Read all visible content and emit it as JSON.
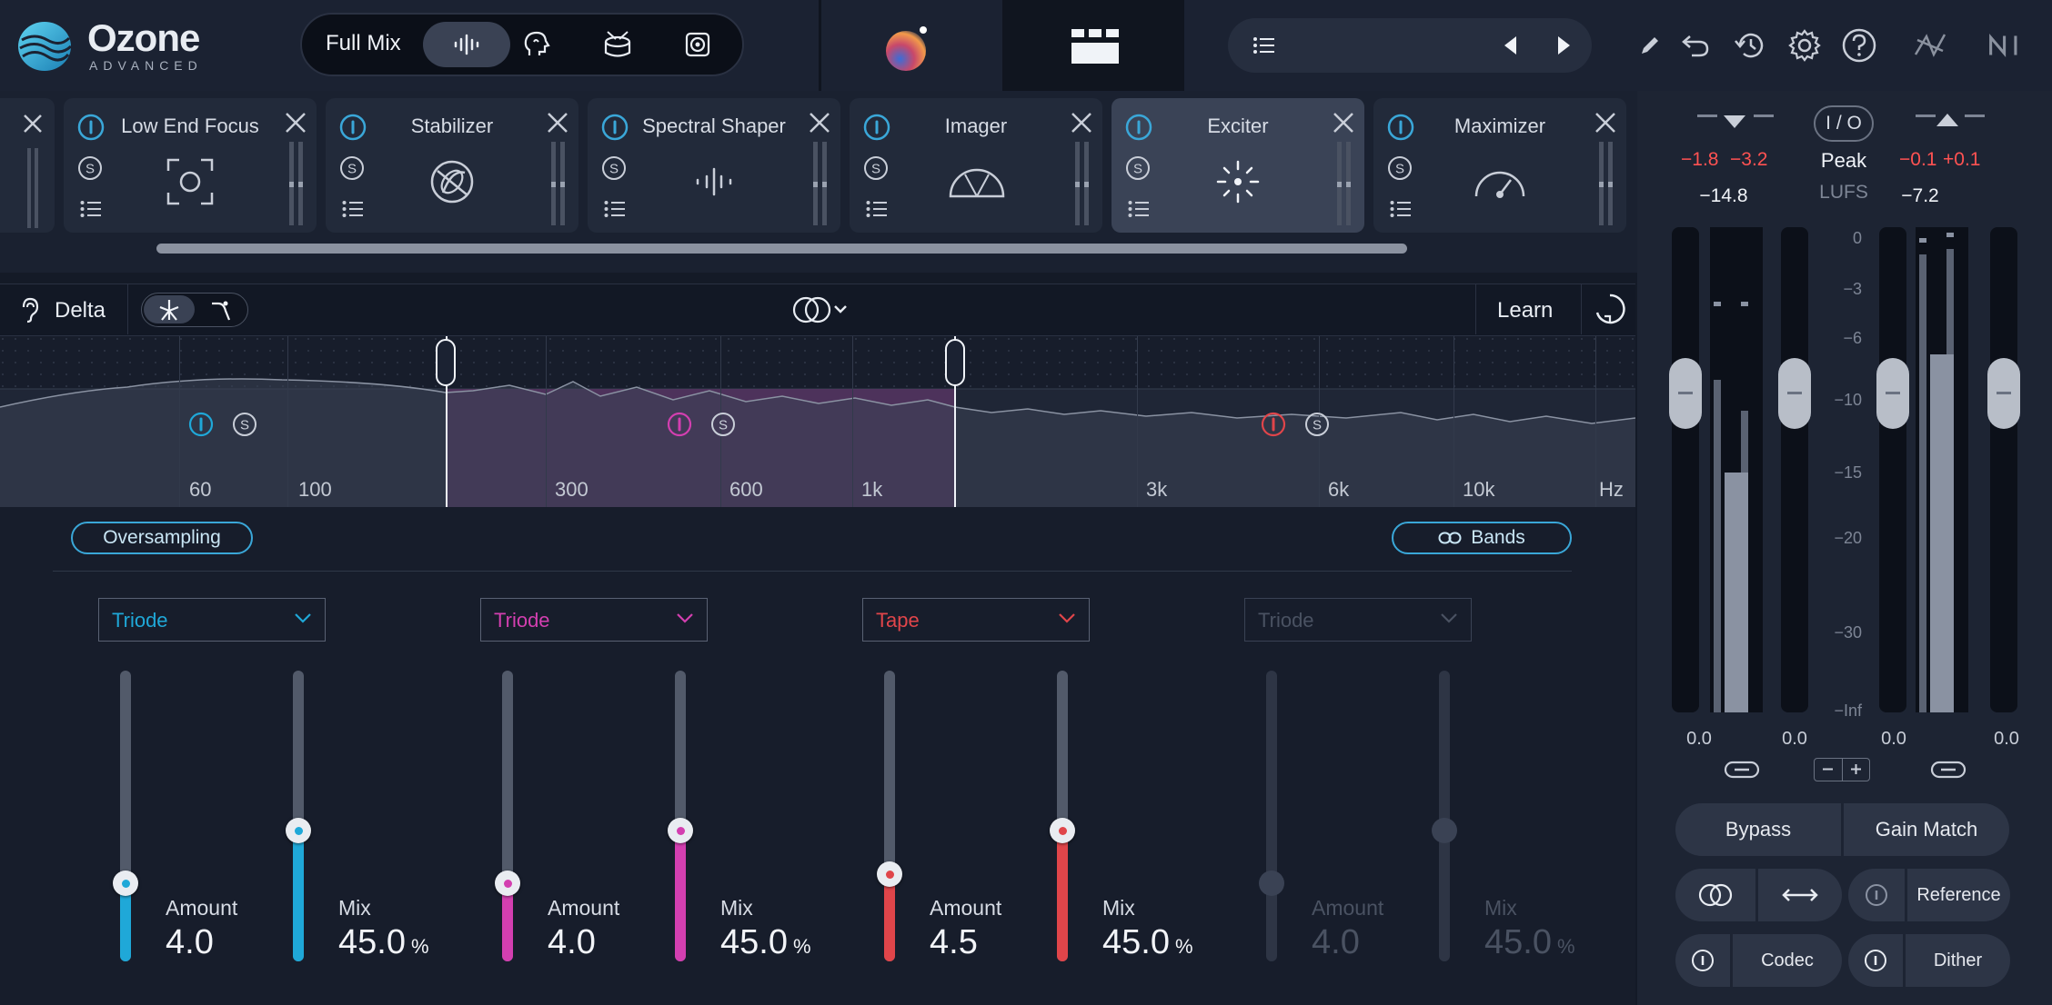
{
  "app": {
    "name": "Ozone",
    "edition": "ADVANCED"
  },
  "mix_selector": {
    "label": "Full Mix",
    "modes": [
      {
        "name": "waveform-icon",
        "selected": true
      },
      {
        "name": "vocal-icon",
        "selected": false
      },
      {
        "name": "drums-icon",
        "selected": false
      },
      {
        "name": "speaker-icon",
        "selected": false
      }
    ]
  },
  "header_icons": [
    "list-icon",
    "previous-arrow-icon",
    "next-arrow-icon",
    "pencil-icon",
    "undo-icon",
    "history-icon",
    "settings-gear-icon",
    "help-icon",
    "signal-chain-icon",
    "ni-logo-icon"
  ],
  "modules": [
    {
      "name": "Low End Focus",
      "icon": "focus-target-icon",
      "active": false
    },
    {
      "name": "Stabilizer",
      "icon": "stabilizer-icon",
      "active": false
    },
    {
      "name": "Spectral Shaper",
      "icon": "spectral-icon",
      "active": false
    },
    {
      "name": "Imager",
      "icon": "imager-arc-icon",
      "active": false
    },
    {
      "name": "Exciter",
      "icon": "exciter-spark-icon",
      "active": true
    },
    {
      "name": "Maximizer",
      "icon": "maximizer-gauge-icon",
      "active": false
    }
  ],
  "toolbar": {
    "delta": "Delta",
    "learn": "Learn"
  },
  "spectrum": {
    "freq_labels": [
      "60",
      "100",
      "300",
      "600",
      "1k",
      "3k",
      "6k",
      "10k",
      "Hz"
    ]
  },
  "controls": {
    "oversampling": "Oversampling",
    "bands": "Bands"
  },
  "bands": [
    {
      "mode": "Triode",
      "color": "#1fa8d8",
      "amount_label": "Amount",
      "amount": "4.0",
      "mix_label": "Mix",
      "mix": "45.0",
      "unit": "%",
      "enabled": true,
      "amount_level": 0.27,
      "mix_level": 0.45
    },
    {
      "mode": "Triode",
      "color": "#d33fb0",
      "amount_label": "Amount",
      "amount": "4.0",
      "mix_label": "Mix",
      "mix": "45.0",
      "unit": "%",
      "enabled": true,
      "amount_level": 0.27,
      "mix_level": 0.45
    },
    {
      "mode": "Tape",
      "color": "#e0454a",
      "amount_label": "Amount",
      "amount": "4.5",
      "mix_label": "Mix",
      "mix": "45.0",
      "unit": "%",
      "enabled": true,
      "amount_level": 0.3,
      "mix_level": 0.45
    },
    {
      "mode": "Triode",
      "color": "#5b6373",
      "amount_label": "Amount",
      "amount": "4.0",
      "mix_label": "Mix",
      "mix": "45.0",
      "unit": "%",
      "enabled": false,
      "amount_level": 0.27,
      "mix_level": 0.45
    }
  ],
  "meters": {
    "io_label": "I / O",
    "in_peaks": [
      "−1.8",
      "−3.2"
    ],
    "in_lufs": "−14.8",
    "out_peaks": [
      "−0.1",
      "+0.1"
    ],
    "out_lufs": "−7.2",
    "peak_label": "Peak",
    "lufs_label": "LUFS",
    "scale": [
      "0",
      "−3",
      "−6",
      "−10",
      "−15",
      "−20",
      "−30",
      "−Inf"
    ],
    "gains": [
      "0.0",
      "0.0",
      "0.0",
      "0.0"
    ]
  },
  "bottom_buttons": {
    "bypass": "Bypass",
    "gain_match": "Gain Match",
    "reference": "Reference",
    "codec": "Codec",
    "dither": "Dither"
  }
}
